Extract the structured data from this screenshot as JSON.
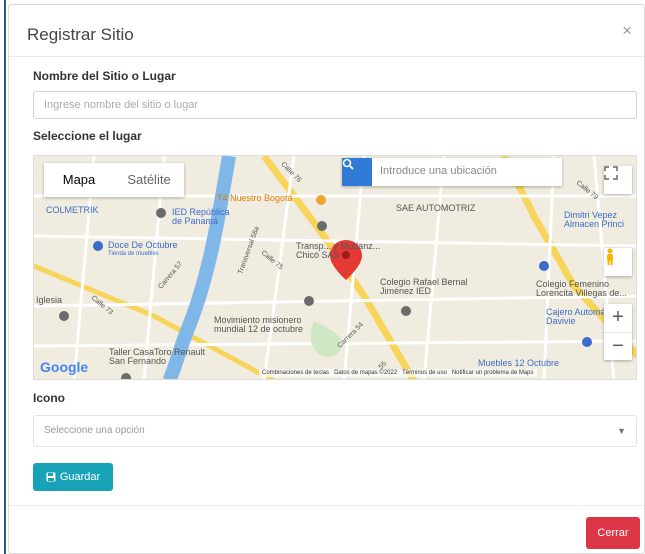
{
  "modal": {
    "title": "Registrar Sitio",
    "close_symbol": "×"
  },
  "form": {
    "name_label": "Nombre del Sitio o Lugar",
    "name_placeholder": "Ingrese nombre del sitio o lugar",
    "place_label": "Seleccione el lugar",
    "icon_label": "Icono",
    "icon_select_placeholder": "Seleccione una opción",
    "save_label": "Guardar",
    "close_label": "Cerrar"
  },
  "map": {
    "type_map": "Mapa",
    "type_satellite": "Satélite",
    "search_placeholder": "Introduce una ubicación",
    "footer_shortcuts": "Combinaciones de teclas",
    "footer_data": "Datos de mapas ©2022",
    "footer_terms": "Términos de uso",
    "footer_report": "Notificar un problema de Maps",
    "google": "Google",
    "pois": [
      {
        "text": "T4 Nuestro Bogotá",
        "color": "orange"
      },
      {
        "text": "SAE AUTOMOTRIZ",
        "color": "gray"
      },
      {
        "text": "COLMETRIK",
        "color": "blue"
      },
      {
        "text": "IED República de Panamá",
        "color": "gray"
      },
      {
        "text": "Dimitri Vepez Almacen Princi",
        "color": "blue"
      },
      {
        "text": "Doce De Octubre",
        "color": "blue"
      },
      {
        "text": "Tienda de muebles",
        "color": "blue"
      },
      {
        "text": "Transp... y Mudanz... Chicó SAS",
        "color": "gray"
      },
      {
        "text": "Colegio Rafael Bernal Jiménez IED",
        "color": "gray"
      },
      {
        "text": "Colegio Femenino Lorencita Villegas de...",
        "color": "gray"
      },
      {
        "text": "Iglesia",
        "color": "gray"
      },
      {
        "text": "Movimiento misionero mundial 12 de octubre",
        "color": "gray"
      },
      {
        "text": "Cajero Automá Davivie",
        "color": "blue"
      },
      {
        "text": "Taller CasaToro Renault San Fernando",
        "color": "gray"
      },
      {
        "text": "Muebles 12 Octubre",
        "color": "blue"
      }
    ],
    "streets": [
      {
        "text": "Calle 76"
      },
      {
        "text": "Transversal 58a"
      },
      {
        "text": "Calle 75"
      },
      {
        "text": "Carrera 57"
      },
      {
        "text": "Calle 73"
      },
      {
        "text": "Calle 79"
      },
      {
        "text": "Carrera 54"
      },
      {
        "text": "55"
      }
    ]
  },
  "colors": {
    "primary_button": "#17a2b8",
    "danger_button": "#dc3545",
    "map_pin": "#e53935",
    "search_button": "#2f7bd6"
  }
}
